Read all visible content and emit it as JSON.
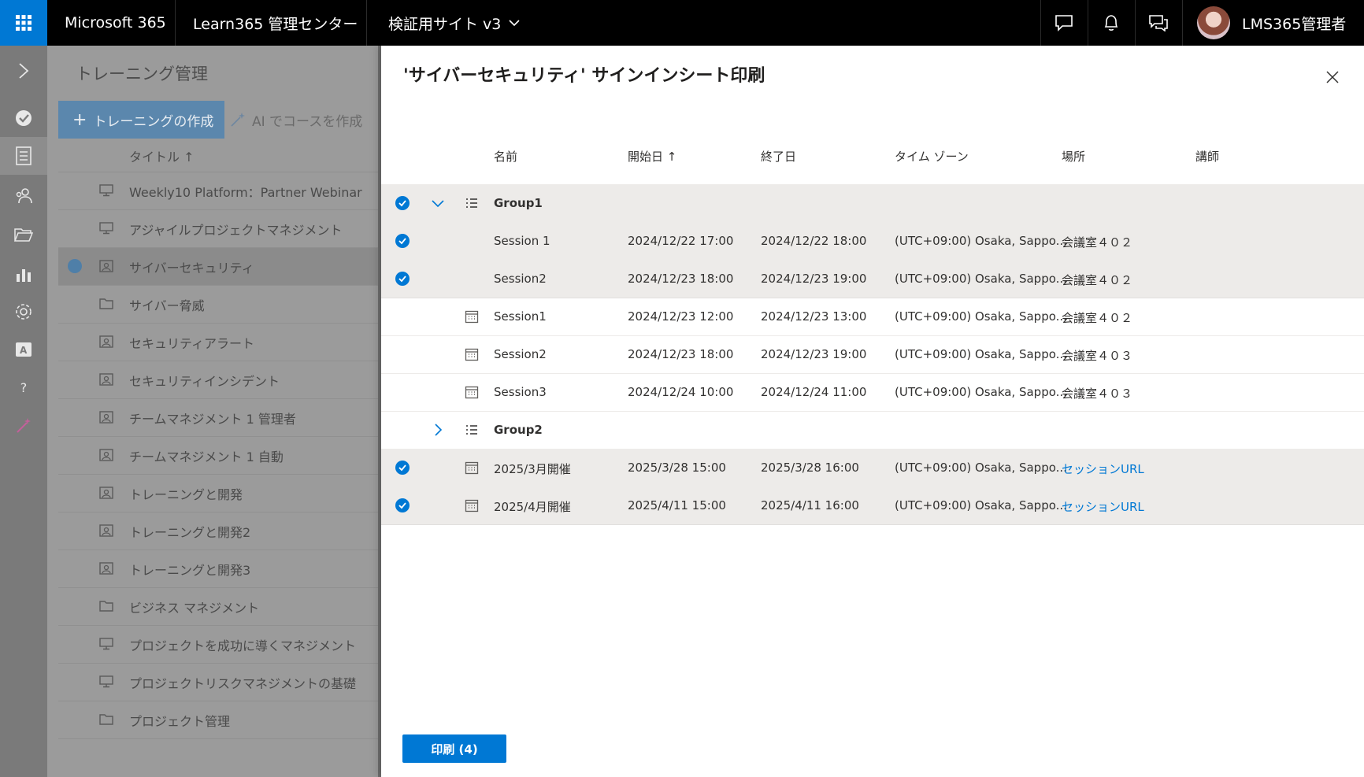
{
  "topbar": {
    "app_name": "Microsoft 365",
    "admin_center": "Learn365 管理センター",
    "site_selector": "検証用サイト v3",
    "user_name": "LMS365管理者"
  },
  "background_page": {
    "title": "トレーニング管理",
    "create_button": "トレーニングの作成",
    "ai_button": "AI でコースを作成",
    "column_title": "タイトル ↑",
    "items": [
      {
        "label": "Weekly10 Platform：Partner Webinar",
        "icon": "monitor-icon"
      },
      {
        "label": "アジャイルプロジェクトマネジメント",
        "icon": "monitor-icon"
      },
      {
        "label": "サイバーセキュリティ",
        "icon": "classroom-icon"
      },
      {
        "label": "サイバー脅威",
        "icon": "folder-icon"
      },
      {
        "label": "セキュリティアラート",
        "icon": "classroom-icon"
      },
      {
        "label": "セキュリティインシデント",
        "icon": "classroom-icon"
      },
      {
        "label": "チームマネジメント 1 管理者",
        "icon": "classroom-icon"
      },
      {
        "label": "チームマネジメント 1 自動",
        "icon": "classroom-icon"
      },
      {
        "label": "トレーニングと開発",
        "icon": "classroom-icon"
      },
      {
        "label": "トレーニングと開発2",
        "icon": "classroom-icon"
      },
      {
        "label": "トレーニングと開発3",
        "icon": "classroom-icon"
      },
      {
        "label": "ビジネス マネジメント",
        "icon": "folder-icon"
      },
      {
        "label": "プロジェクトを成功に導くマネジメント",
        "icon": "monitor-icon"
      },
      {
        "label": "プロジェクトリスクマネジメントの基礎",
        "icon": "monitor-icon"
      },
      {
        "label": "プロジェクト管理",
        "icon": "folder-icon"
      }
    ]
  },
  "panel": {
    "title": "'サイバーセキュリティ' サインインシート印刷",
    "columns": {
      "name": "名前",
      "start": "開始日 ↑",
      "end": "終了日",
      "timezone": "タイム ゾーン",
      "location": "場所",
      "instructor": "講師"
    },
    "rows": [
      {
        "type": "group",
        "name": "Group1",
        "checked": true,
        "expanded": true
      },
      {
        "type": "session",
        "name": "Session 1",
        "start": "2024/12/22 17:00",
        "end": "2024/12/22 18:00",
        "timezone": "(UTC+09:00) Osaka, Sappo...",
        "location": "会議室４０２",
        "checked": true,
        "icon": false
      },
      {
        "type": "session",
        "name": "Session2",
        "start": "2024/12/23 18:00",
        "end": "2024/12/23 19:00",
        "timezone": "(UTC+09:00) Osaka, Sappo...",
        "location": "会議室４０２",
        "checked": true,
        "icon": false
      },
      {
        "type": "session",
        "name": "Session1",
        "start": "2024/12/23 12:00",
        "end": "2024/12/23 13:00",
        "timezone": "(UTC+09:00) Osaka, Sappo...",
        "location": "会議室４０２",
        "checked": false,
        "icon": true
      },
      {
        "type": "session",
        "name": "Session2",
        "start": "2024/12/23 18:00",
        "end": "2024/12/23 19:00",
        "timezone": "(UTC+09:00) Osaka, Sappo...",
        "location": "会議室４０３",
        "checked": false,
        "icon": true
      },
      {
        "type": "session",
        "name": "Session3",
        "start": "2024/12/24 10:00",
        "end": "2024/12/24 11:00",
        "timezone": "(UTC+09:00) Osaka, Sappo...",
        "location": "会議室４０３",
        "checked": false,
        "icon": true
      },
      {
        "type": "group",
        "name": "Group2",
        "checked": false,
        "expanded": false
      },
      {
        "type": "session",
        "name": "2025/3月開催",
        "start": "2025/3/28 15:00",
        "end": "2025/3/28 16:00",
        "timezone": "(UTC+09:00) Osaka, Sappo...",
        "location": "セッションURL",
        "location_is_link": true,
        "checked": true,
        "icon": true
      },
      {
        "type": "session",
        "name": "2025/4月開催",
        "start": "2025/4/11 15:00",
        "end": "2025/4/11 16:00",
        "timezone": "(UTC+09:00) Osaka, Sappo...",
        "location": "セッションURL",
        "location_is_link": true,
        "checked": true,
        "icon": true
      }
    ],
    "print_button": "印刷 (4)"
  },
  "colors": {
    "accent": "#0078d4",
    "topbar": "#000000",
    "selected_row": "#edebe9"
  }
}
